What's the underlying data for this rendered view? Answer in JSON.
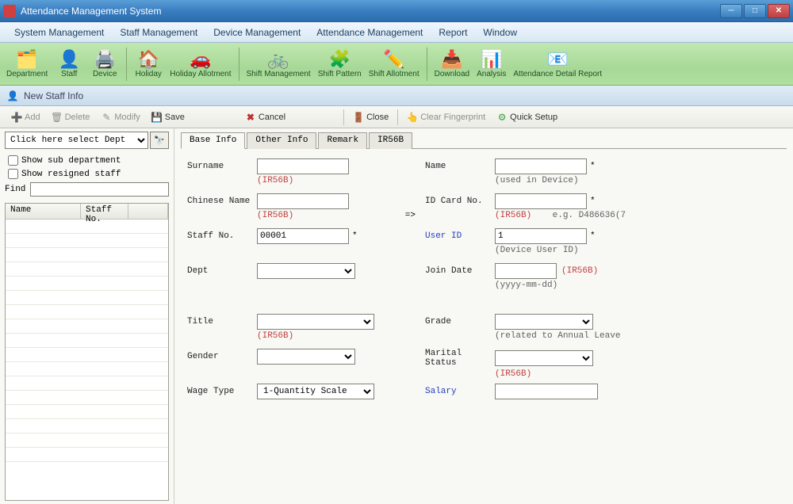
{
  "window": {
    "title": "Attendance Management System"
  },
  "menubar": {
    "items": [
      "System Management",
      "Staff Management",
      "Device Management",
      "Attendance Management",
      "Report",
      "Window"
    ]
  },
  "toolbar": {
    "items": [
      {
        "label": "Department",
        "icon": "🗂️"
      },
      {
        "label": "Staff",
        "icon": "👤"
      },
      {
        "label": "Device",
        "icon": "🖨️"
      },
      {
        "label": "Holiday",
        "icon": "🏠"
      },
      {
        "label": "Holiday Allotment",
        "icon": "🚗"
      },
      {
        "label": "Shift Management",
        "icon": "🚲"
      },
      {
        "label": "Shift Pattern",
        "icon": "🧩"
      },
      {
        "label": "Shift Allotment",
        "icon": "✏️"
      },
      {
        "label": "Download",
        "icon": "📥"
      },
      {
        "label": "Analysis",
        "icon": "📊"
      },
      {
        "label": "Attendance Detail Report",
        "icon": "📧"
      }
    ]
  },
  "panel": {
    "title": "New Staff Info"
  },
  "actions": {
    "add": "Add",
    "delete": "Delete",
    "modify": "Modify",
    "save": "Save",
    "cancel": "Cancel",
    "close": "Close",
    "clear_fp": "Clear Fingerprint",
    "quick_setup": "Quick Setup"
  },
  "sidebar": {
    "dept_placeholder": "Click here select Dept",
    "show_sub": "Show sub department",
    "show_resigned": "Show resigned staff",
    "find_label": "Find",
    "columns": {
      "name": "Name",
      "staff_no": "Staff No."
    }
  },
  "tabs": {
    "items": [
      "Base Info",
      "Other Info",
      "Remark",
      "IR56B"
    ],
    "active": 0
  },
  "form": {
    "surname": {
      "label": "Surname",
      "value": "",
      "hint": "(IR56B)"
    },
    "name": {
      "label": "Name",
      "value": "",
      "hint": "(used in Device)"
    },
    "chinese_name": {
      "label": "Chinese Name",
      "value": "",
      "hint": "(IR56B)",
      "arrow": "=>"
    },
    "id_card": {
      "label": "ID Card No.",
      "value": "",
      "hint": "(IR56B)",
      "hint2": "e.g. D486636(7"
    },
    "staff_no": {
      "label": "Staff No.",
      "value": "00001"
    },
    "user_id": {
      "label": "User ID",
      "value": "1",
      "hint": "(Device User ID)"
    },
    "dept": {
      "label": "Dept",
      "value": ""
    },
    "join_date": {
      "label": "Join Date",
      "value": "",
      "hint": "(IR56B)",
      "hint2": "(yyyy-mm-dd)"
    },
    "title": {
      "label": "Title",
      "value": "",
      "hint": "(IR56B)"
    },
    "grade": {
      "label": "Grade",
      "value": "",
      "hint": "(related to Annual Leave"
    },
    "gender": {
      "label": "Gender",
      "value": ""
    },
    "marital": {
      "label": "Marital Status",
      "value": "",
      "hint": "(IR56B)"
    },
    "wage_type": {
      "label": "Wage Type",
      "value": "1-Quantity Scale"
    },
    "salary": {
      "label": "Salary",
      "value": ""
    }
  }
}
